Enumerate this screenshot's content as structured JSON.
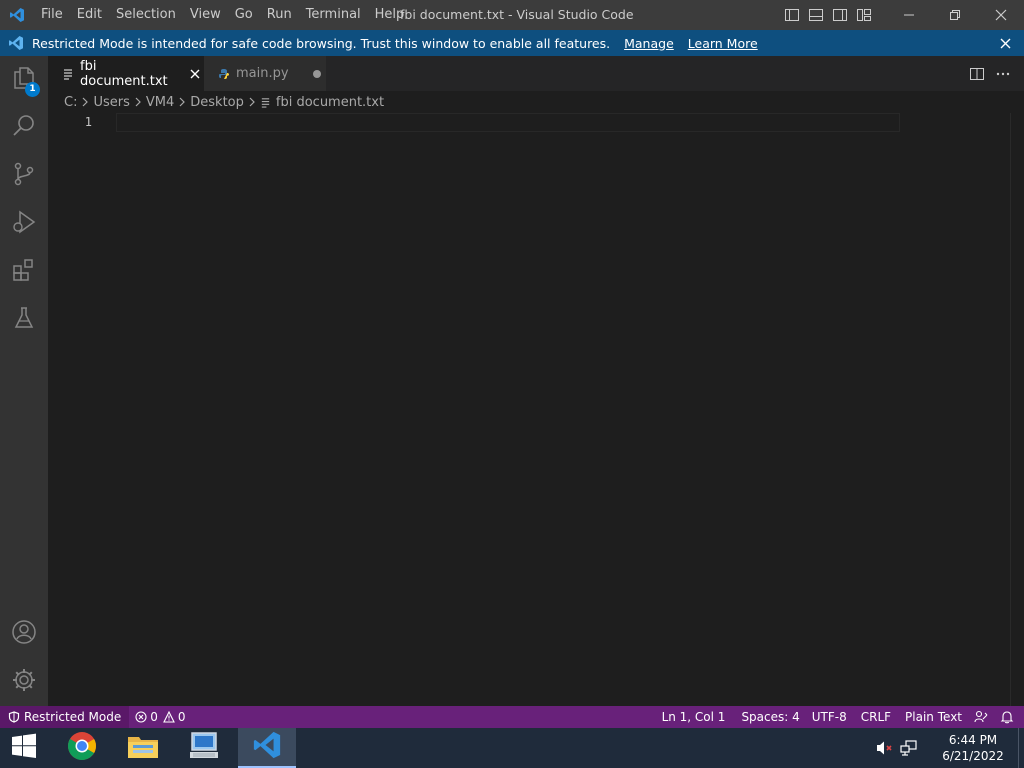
{
  "titlebar": {
    "menu": [
      "File",
      "Edit",
      "Selection",
      "View",
      "Go",
      "Run",
      "Terminal",
      "Help"
    ],
    "window_title": "fbi document.txt - Visual Studio Code",
    "app_icon": "vscode-logo"
  },
  "banner": {
    "message": "Restricted Mode is intended for safe code browsing. Trust this window to enable all features.",
    "manage_label": "Manage",
    "learn_more_label": "Learn More"
  },
  "activity_bar": {
    "explorer_badge": "1",
    "items": [
      "explorer",
      "search",
      "source-control",
      "run-and-debug",
      "extensions",
      "testing"
    ],
    "bottom_items": [
      "accounts",
      "manage"
    ]
  },
  "tabs": [
    {
      "label": "fbi document.txt",
      "active": true,
      "icon": "text-file-icon"
    },
    {
      "label": "main.py",
      "active": false,
      "icon": "python-file-icon",
      "dirty": true
    }
  ],
  "breadcrumb": {
    "items": [
      "C:",
      "Users",
      "VM4",
      "Desktop",
      "fbi document.txt"
    ]
  },
  "editor": {
    "line_numbers": [
      "1"
    ]
  },
  "statusbar": {
    "restricted_label": "Restricted Mode",
    "errors": "0",
    "warnings": "0",
    "position": "Ln 1, Col 1",
    "spaces": "Spaces: 4",
    "encoding": "UTF-8",
    "eol": "CRLF",
    "language": "Plain Text"
  },
  "taskbar": {
    "time": "6:44 PM",
    "date": "6/21/2022"
  },
  "colors": {
    "statusbar": "#68217a",
    "banner": "#0e4f7f",
    "titlebar": "#3c3c3c",
    "editor": "#1e1e1e"
  }
}
